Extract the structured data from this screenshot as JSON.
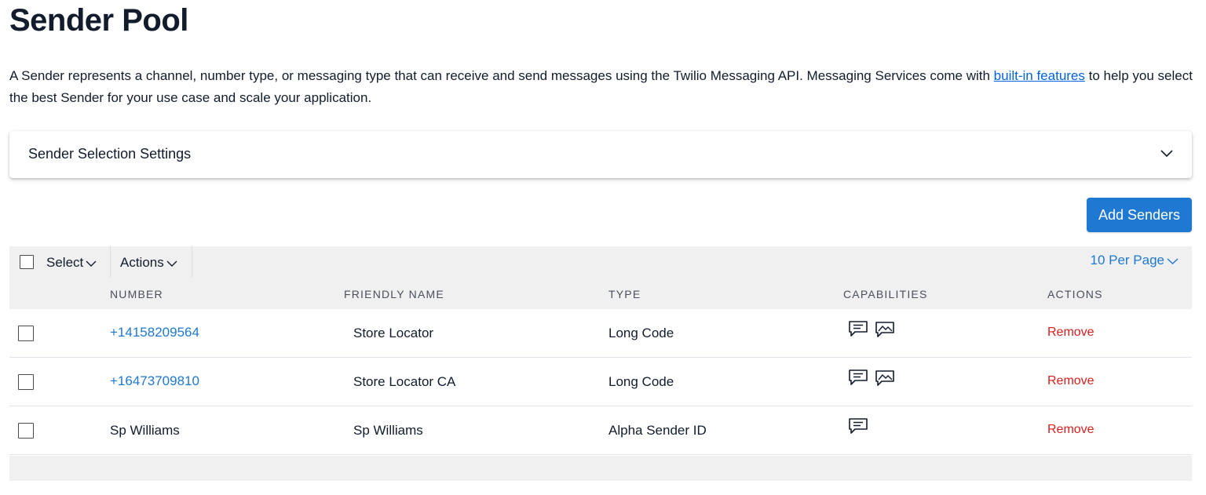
{
  "page": {
    "title": "Sender Pool",
    "intro_text_1": "A Sender represents a channel, number type, or messaging type that can receive and send messages using the Twilio Messaging API. Messaging Services come with ",
    "intro_link": "built-in features",
    "intro_text_2": " to help you select the best Sender for your use case and scale your application."
  },
  "settings": {
    "label": "Sender Selection Settings",
    "expand_icon": "chevron-down-icon"
  },
  "add_senders_label": "Add Senders",
  "toolbar": {
    "select_label": "Select",
    "actions_label": "Actions",
    "per_page_label": "10 Per Page"
  },
  "table": {
    "columns": [
      "NUMBER",
      "FRIENDLY NAME",
      "TYPE",
      "CAPABILITIES",
      "ACTIONS"
    ],
    "rows": [
      {
        "number": "+14158209564",
        "number_is_link": true,
        "friendly_name": "Store Locator",
        "type": "Long Code",
        "capabilities": [
          "sms-icon",
          "mms-icon"
        ],
        "action": "Remove"
      },
      {
        "number": "+16473709810",
        "number_is_link": true,
        "friendly_name": "Store Locator CA",
        "type": "Long Code",
        "capabilities": [
          "sms-icon",
          "mms-icon"
        ],
        "action": "Remove"
      },
      {
        "number": "Sp Williams",
        "number_is_link": false,
        "friendly_name": "Sp Williams",
        "type": "Alpha Sender ID",
        "capabilities": [
          "sms-icon"
        ],
        "action": "Remove"
      }
    ]
  },
  "colors": {
    "link": "#1f78d1",
    "primary_button": "#1f78d1",
    "remove": "#d61f1f",
    "toolbar_bg": "#f0f0f0"
  }
}
